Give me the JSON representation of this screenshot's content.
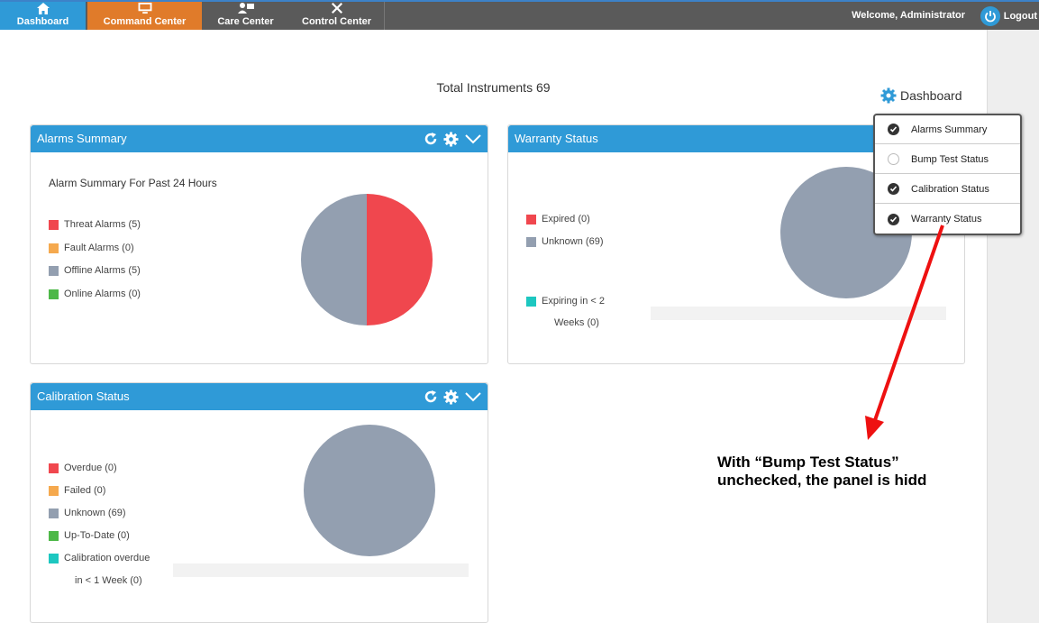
{
  "nav": {
    "tabs": [
      {
        "label": "Dashboard",
        "icon": "home-icon"
      },
      {
        "label": "Command Center",
        "icon": "monitor-icon"
      },
      {
        "label": "Care Center",
        "icon": "care-icon"
      },
      {
        "label": "Control Center",
        "icon": "tools-icon"
      }
    ],
    "welcome": "Welcome, Administrator",
    "logout": "Logout"
  },
  "header": {
    "total": "Total Instruments 69",
    "dashboard_link": "Dashboard"
  },
  "alarms": {
    "title": "Alarms Summary",
    "subtitle": "Alarm Summary For Past 24 Hours",
    "legend": [
      "Threat Alarms (5)",
      "Fault Alarms (0)",
      "Offline Alarms (5)",
      "Online Alarms (0)"
    ]
  },
  "warranty": {
    "title": "Warranty Status",
    "legend": [
      "Expired (0)",
      "Unknown (69)",
      "Expiring in < 2",
      "Weeks (0)"
    ]
  },
  "calibration": {
    "title": "Calibration Status",
    "legend": [
      "Overdue (0)",
      "Failed (0)",
      "Unknown (69)",
      "Up-To-Date (0)",
      "Calibration overdue",
      "in < 1 Week (0)"
    ]
  },
  "popup": {
    "items": [
      {
        "label": "Alarms Summary",
        "checked": true
      },
      {
        "label": "Bump Test Status",
        "checked": false
      },
      {
        "label": "Calibration Status",
        "checked": true
      },
      {
        "label": "Warranty Status",
        "checked": true
      }
    ]
  },
  "annotation": {
    "line1": "With “Bump Test Status”",
    "line2": "unchecked, the panel is hidd"
  },
  "colors": {
    "red": "#f0474e",
    "orange": "#f5a94e",
    "gray": "#939fb0",
    "green": "#4db848",
    "teal": "#1dc7c0",
    "blue": "#2f9ad7"
  }
}
